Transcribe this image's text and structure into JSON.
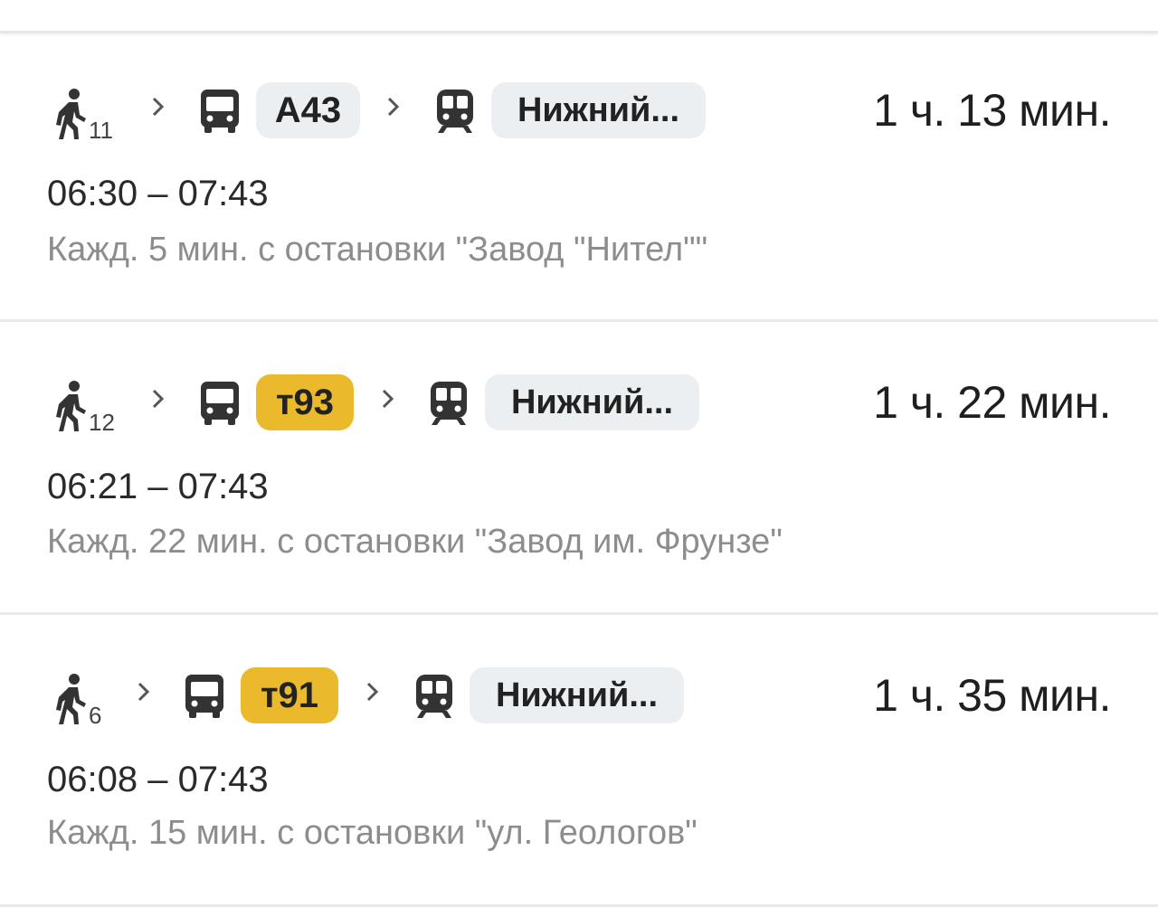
{
  "routes": [
    {
      "walk_minutes": "11",
      "bus_label": "А43",
      "bus_badge_color": "#eceff2",
      "train_label": "Нижний...",
      "duration": "1 ч. 13 мин.",
      "time_range": "06:30 – 07:43",
      "frequency": "Кажд. 5 мин. с остановки \"Завод \"Нител\"\""
    },
    {
      "walk_minutes": "12",
      "bus_label": "т93",
      "bus_badge_color": "#ebba2c",
      "train_label": "Нижний...",
      "duration": "1 ч. 22 мин.",
      "time_range": "06:21 – 07:43",
      "frequency": "Кажд. 22 мин. с остановки \"Завод им. Фрунзе\""
    },
    {
      "walk_minutes": "6",
      "bus_label": "т91",
      "bus_badge_color": "#ebba2c",
      "train_label": "Нижний...",
      "duration": "1 ч. 35 мин.",
      "time_range": "06:08 – 07:43",
      "frequency": "Кажд. 15 мин. с остановки \"ул. Геологов\""
    }
  ],
  "icons": {
    "walk": "walk-icon",
    "chevron": "chevron-right-icon",
    "bus": "bus-icon",
    "train": "train-icon"
  }
}
